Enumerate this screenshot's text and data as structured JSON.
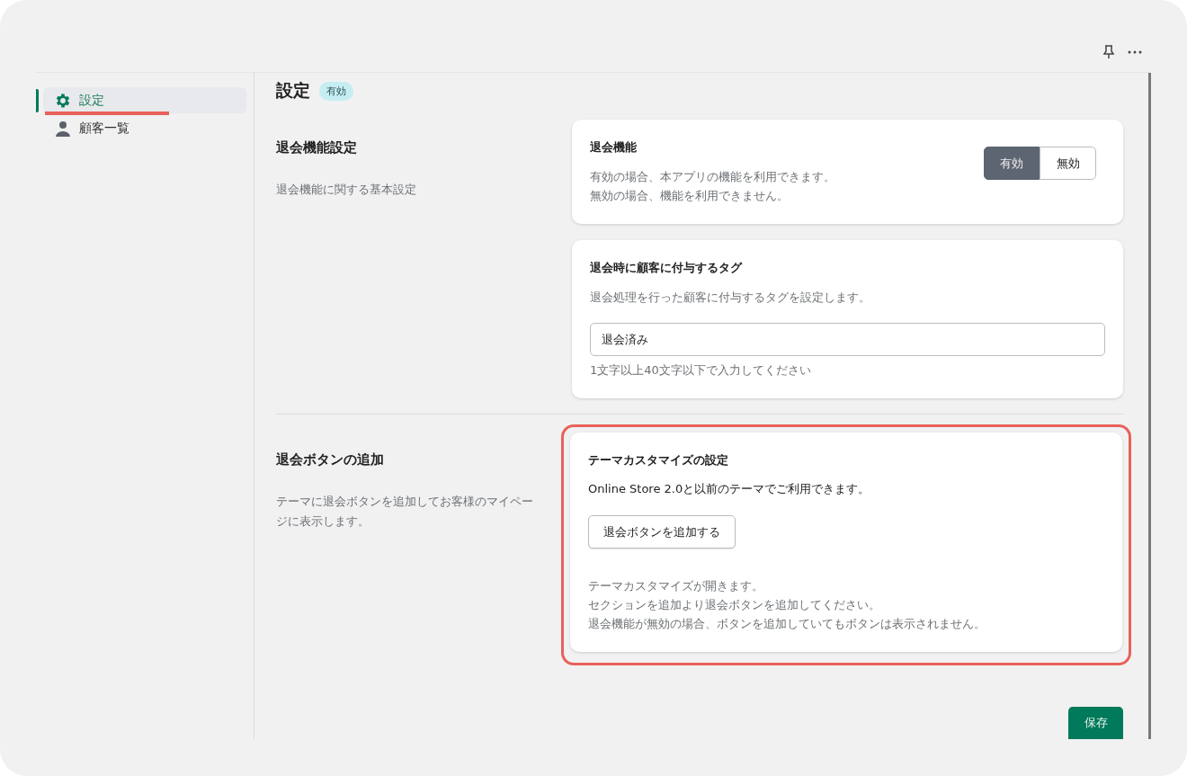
{
  "sidebar": {
    "items": [
      {
        "label": "設定",
        "kind": "settings",
        "selected": true,
        "annotated": true
      },
      {
        "label": "顧客一覧",
        "kind": "customers",
        "selected": false,
        "annotated": false
      }
    ]
  },
  "page": {
    "title": "設定",
    "badge": "有効"
  },
  "sections": [
    {
      "title": "退会機能設定",
      "description": "退会機能に関する基本設定",
      "cards": [
        {
          "kind": "toggle",
          "title": "退会機能",
          "lines": [
            "有効の場合、本アプリの機能を利用できます。",
            "無効の場合、機能を利用できません。"
          ],
          "options": [
            {
              "label": "有効",
              "selected": true
            },
            {
              "label": "無効",
              "selected": false
            }
          ],
          "annotated": false
        },
        {
          "kind": "field",
          "title": "退会時に顧客に付与するタグ",
          "lines": [
            "退会処理を行った顧客に付与するタグを設定します。"
          ],
          "value": "退会済み",
          "help": "1文字以上40文字以下で入力してください",
          "annotated": false
        }
      ]
    },
    {
      "title": "退会ボタンの追加",
      "description": "テーマに退会ボタンを追加してお客様のマイページに表示します。",
      "cards": [
        {
          "kind": "action",
          "title": "テーマカスタマイズの設定",
          "text": "Online Store 2.0と以前のテーマでご利用できます。",
          "button": "退会ボタンを追加する",
          "lines": [
            "テーマカスタマイズが開きます。",
            "セクションを追加より退会ボタンを追加してください。",
            "退会機能が無効の場合、ボタンを追加していてもボタンは表示されません。"
          ],
          "annotated": true
        }
      ]
    }
  ],
  "save_button": "保存"
}
